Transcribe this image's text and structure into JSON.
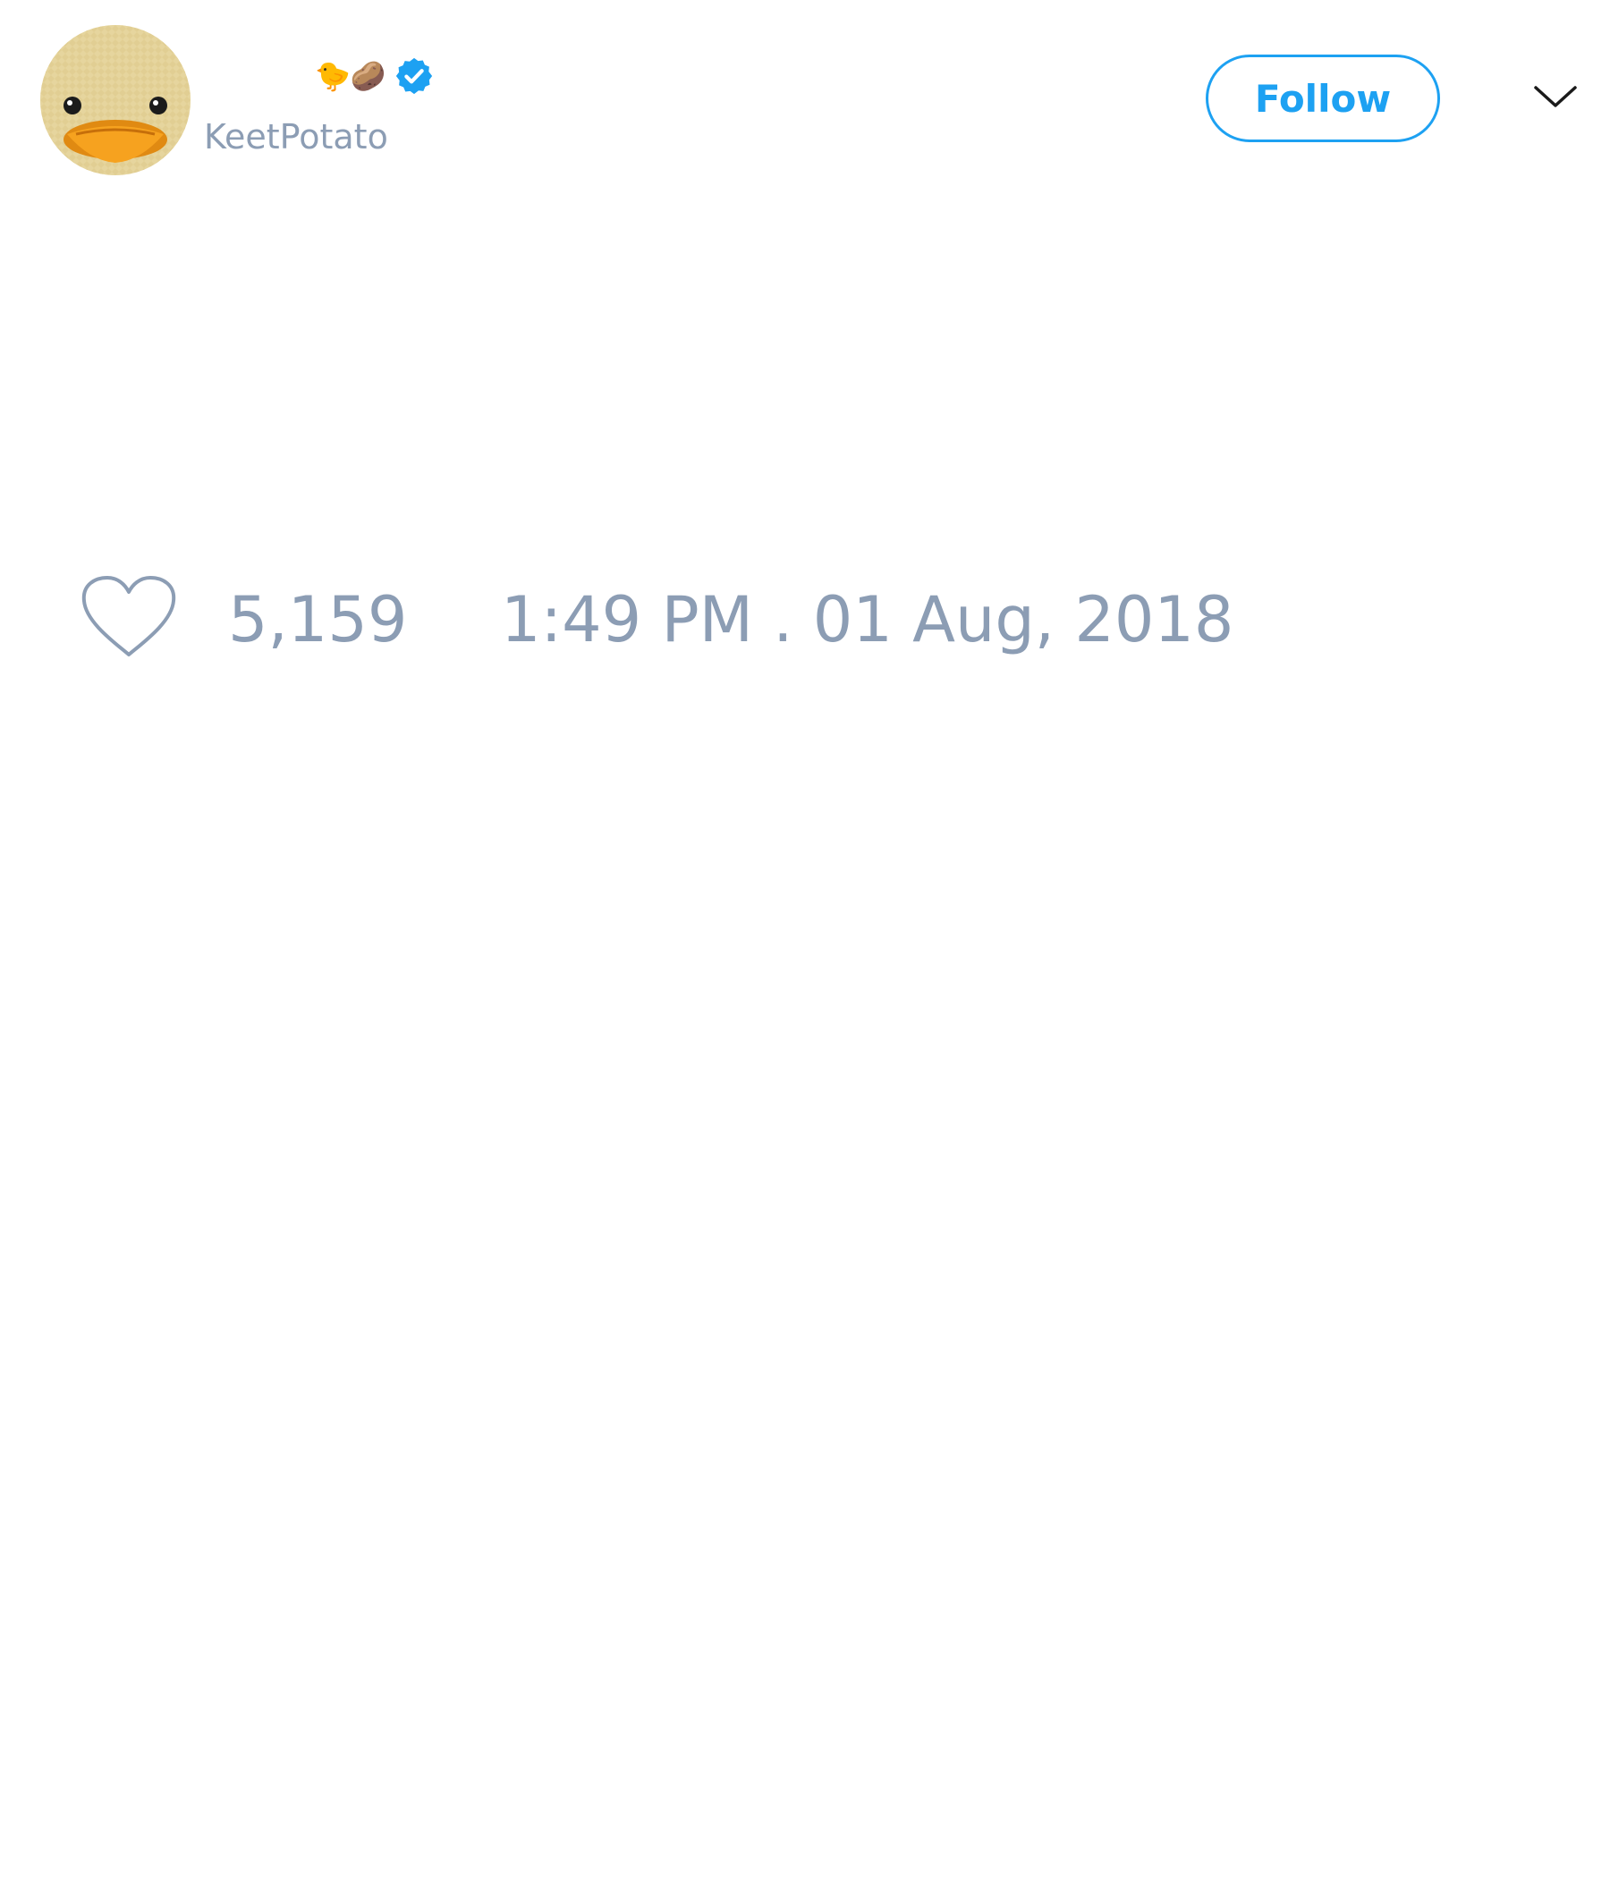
{
  "tweet": {
    "author": {
      "display_emoji": "🐤🥔",
      "handle": "KeetPotato",
      "verified": true
    },
    "follow_label": "Follow",
    "likes": "5,159",
    "timestamp": "1:49 PM . 01 Aug, 2018"
  },
  "icons": {
    "avatar": "duck-face-avatar",
    "verified": "verified-badge-icon",
    "caret": "chevron-down-icon",
    "like": "heart-icon"
  },
  "colors": {
    "accent": "#1da1f2",
    "muted_text": "#8c9db4",
    "heart_outline": "#8c9db4"
  }
}
